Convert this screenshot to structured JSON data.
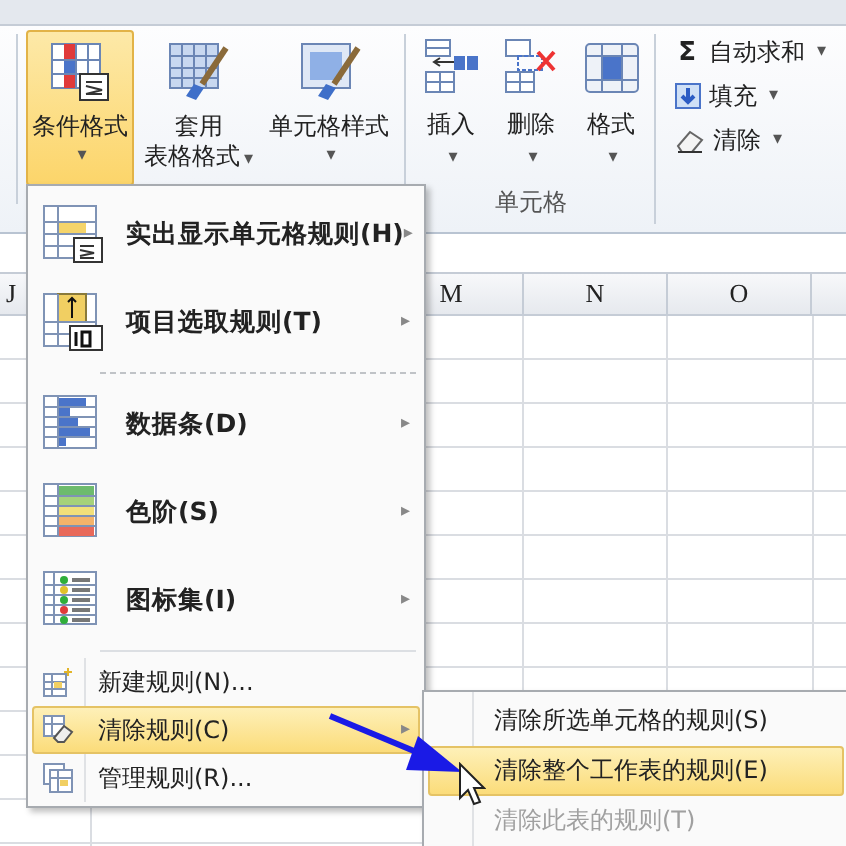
{
  "ribbon": {
    "styles": [
      {
        "kind": "conditional",
        "lines": [
          "条件格式"
        ],
        "caret": "▾",
        "selected": true
      },
      {
        "kind": "table",
        "lines": [
          "套用",
          "表格格式"
        ],
        "caret": "▾",
        "selected": false
      },
      {
        "kind": "cellstyle",
        "lines": [
          "单元格样式"
        ],
        "caret": "▾",
        "selected": false
      }
    ],
    "cells": {
      "buttons": [
        {
          "kind": "insert",
          "label": "插入",
          "caret": "▾"
        },
        {
          "kind": "delete",
          "label": "删除",
          "caret": "▾"
        },
        {
          "kind": "format",
          "label": "格式",
          "caret": "▾"
        }
      ],
      "label": "单元格"
    },
    "editing": [
      {
        "kind": "sum",
        "icon_text": "Σ",
        "label": "自动求和",
        "caret": "▾"
      },
      {
        "kind": "fill",
        "label": "填充",
        "caret": "▾"
      },
      {
        "kind": "clear",
        "label": "清除",
        "caret": "▾"
      }
    ]
  },
  "columns": [
    "J",
    "M",
    "N",
    "O"
  ],
  "menu": {
    "items": [
      {
        "kind": "highlight",
        "label": "实出显示单元格规则",
        "key": "(H)",
        "arrow": "▸",
        "selected": false
      },
      {
        "kind": "top10",
        "label": "项目选取规则",
        "key": "(T)",
        "arrow": "▸",
        "selected": false
      },
      {
        "kind": "dashed_divider"
      },
      {
        "kind": "databar",
        "label": "数据条",
        "key": "(D)",
        "arrow": "▸",
        "selected": false
      },
      {
        "kind": "scale",
        "label": "色阶",
        "key": "(S)",
        "arrow": "▸",
        "selected": false
      },
      {
        "kind": "iconset",
        "label": "图标集",
        "key": "(I)",
        "arrow": "▸",
        "selected": false
      },
      {
        "kind": "divider"
      },
      {
        "kind": "new",
        "label": "新建规则(N)...",
        "selected": false
      },
      {
        "kind": "clear",
        "label": "清除规则(C)",
        "arrow": "▸",
        "selected": true
      },
      {
        "kind": "manage",
        "label": "管理规则(R)...",
        "selected": false
      }
    ]
  },
  "submenu": {
    "items": [
      {
        "label": "清除所选单元格的规则(S)",
        "selected": false,
        "disabled": false
      },
      {
        "label": "清除整个工作表的规则(E)",
        "selected": true,
        "disabled": false
      },
      {
        "label": "清除此表的规则(T)",
        "selected": false,
        "disabled": true
      }
    ]
  }
}
